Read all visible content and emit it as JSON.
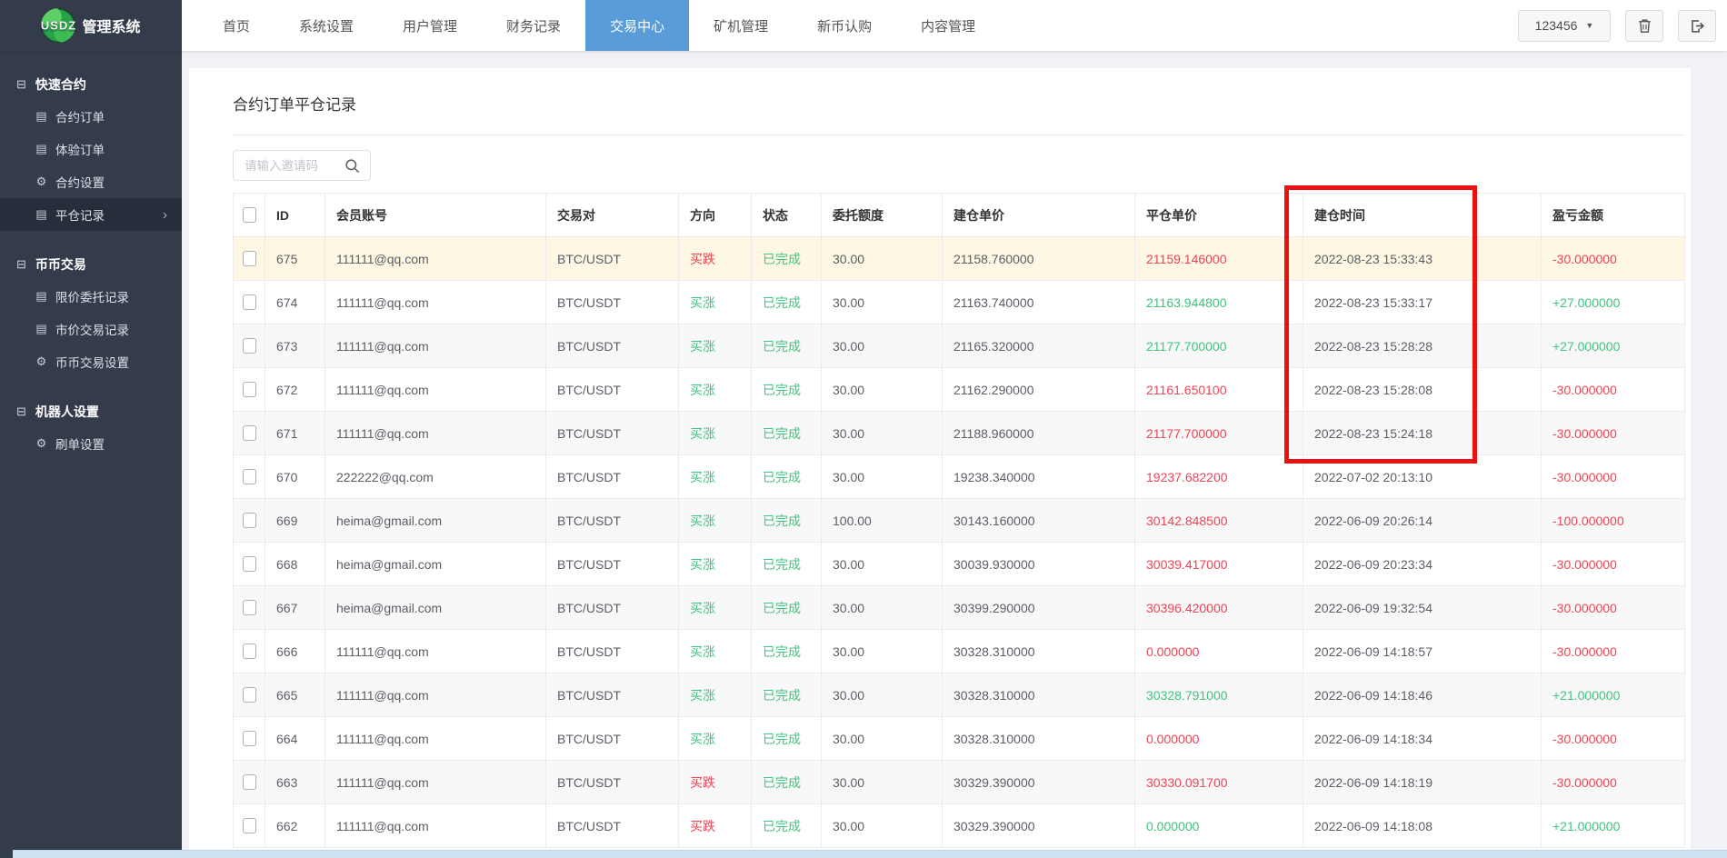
{
  "colors": {
    "nav_active_blue": "#5a9cd8",
    "green": "#3fc47f",
    "red": "#ef4455",
    "annotation_red": "#ec1111",
    "sidebar_bg": "#343b4a",
    "row_highlight": "#fdf7e3"
  },
  "topbar": {
    "brand": "USDZ",
    "brand_title": "管理系统",
    "nav": [
      {
        "label": "首页",
        "active": false
      },
      {
        "label": "系统设置",
        "active": false
      },
      {
        "label": "用户管理",
        "active": false
      },
      {
        "label": "财务记录",
        "active": false
      },
      {
        "label": "交易中心",
        "active": true
      },
      {
        "label": "矿机管理",
        "active": false
      },
      {
        "label": "新币认购",
        "active": false
      },
      {
        "label": "内容管理",
        "active": false
      }
    ],
    "account_dropdown": "123456",
    "icons": [
      "dropdown-caret",
      "trash-icon",
      "logout-icon"
    ]
  },
  "sidebar": {
    "groups": [
      {
        "label": "快速合约",
        "items": [
          {
            "label": "合约订单",
            "icon": "list-icon",
            "active": false
          },
          {
            "label": "体验订单",
            "icon": "list-icon",
            "active": false
          },
          {
            "label": "合约设置",
            "icon": "gear-icon",
            "active": false
          },
          {
            "label": "平仓记录",
            "icon": "list-icon",
            "active": true
          }
        ]
      },
      {
        "label": "币币交易",
        "items": [
          {
            "label": "限价委托记录",
            "icon": "list-icon",
            "active": false
          },
          {
            "label": "市价交易记录",
            "icon": "list-icon",
            "active": false
          },
          {
            "label": "币币交易设置",
            "icon": "gear-icon",
            "active": false
          }
        ]
      },
      {
        "label": "机器人设置",
        "items": [
          {
            "label": "刷单设置",
            "icon": "gear-icon",
            "active": false
          }
        ]
      }
    ]
  },
  "main": {
    "title": "合约订单平仓记录",
    "search_placeholder": "请输入邀请码",
    "table": {
      "columns": [
        "ID",
        "会员账号",
        "交易对",
        "方向",
        "状态",
        "委托额度",
        "建仓单价",
        "平仓单价",
        "建仓时间",
        "盈亏金额"
      ],
      "rows": [
        {
          "id": "675",
          "account": "111111@qq.com",
          "pair": "BTC/USDT",
          "direction": "买跌",
          "direction_color": "red",
          "status": "已完成",
          "amount": "30.00",
          "open_price": "21158.760000",
          "close_price": "21159.146000",
          "close_color": "red",
          "open_time": "2022-08-23 15:33:43",
          "pnl": "-30.000000",
          "pnl_color": "red",
          "highlight": true
        },
        {
          "id": "674",
          "account": "111111@qq.com",
          "pair": "BTC/USDT",
          "direction": "买涨",
          "direction_color": "green",
          "status": "已完成",
          "amount": "30.00",
          "open_price": "21163.740000",
          "close_price": "21163.944800",
          "close_color": "green",
          "open_time": "2022-08-23 15:33:17",
          "pnl": "+27.000000",
          "pnl_color": "green",
          "highlight": false
        },
        {
          "id": "673",
          "account": "111111@qq.com",
          "pair": "BTC/USDT",
          "direction": "买涨",
          "direction_color": "green",
          "status": "已完成",
          "amount": "30.00",
          "open_price": "21165.320000",
          "close_price": "21177.700000",
          "close_color": "green",
          "open_time": "2022-08-23 15:28:28",
          "pnl": "+27.000000",
          "pnl_color": "green",
          "highlight": false
        },
        {
          "id": "672",
          "account": "111111@qq.com",
          "pair": "BTC/USDT",
          "direction": "买涨",
          "direction_color": "green",
          "status": "已完成",
          "amount": "30.00",
          "open_price": "21162.290000",
          "close_price": "21161.650100",
          "close_color": "red",
          "open_time": "2022-08-23 15:28:08",
          "pnl": "-30.000000",
          "pnl_color": "red",
          "highlight": false
        },
        {
          "id": "671",
          "account": "111111@qq.com",
          "pair": "BTC/USDT",
          "direction": "买涨",
          "direction_color": "green",
          "status": "已完成",
          "amount": "30.00",
          "open_price": "21188.960000",
          "close_price": "21177.700000",
          "close_color": "red",
          "open_time": "2022-08-23 15:24:18",
          "pnl": "-30.000000",
          "pnl_color": "red",
          "highlight": false
        },
        {
          "id": "670",
          "account": "222222@qq.com",
          "pair": "BTC/USDT",
          "direction": "买涨",
          "direction_color": "green",
          "status": "已完成",
          "amount": "30.00",
          "open_price": "19238.340000",
          "close_price": "19237.682200",
          "close_color": "red",
          "open_time": "2022-07-02 20:13:10",
          "pnl": "-30.000000",
          "pnl_color": "red",
          "highlight": false
        },
        {
          "id": "669",
          "account": "heima@gmail.com",
          "pair": "BTC/USDT",
          "direction": "买涨",
          "direction_color": "green",
          "status": "已完成",
          "amount": "100.00",
          "open_price": "30143.160000",
          "close_price": "30142.848500",
          "close_color": "red",
          "open_time": "2022-06-09 20:26:14",
          "pnl": "-100.000000",
          "pnl_color": "red",
          "highlight": false
        },
        {
          "id": "668",
          "account": "heima@gmail.com",
          "pair": "BTC/USDT",
          "direction": "买涨",
          "direction_color": "green",
          "status": "已完成",
          "amount": "30.00",
          "open_price": "30039.930000",
          "close_price": "30039.417000",
          "close_color": "red",
          "open_time": "2022-06-09 20:23:34",
          "pnl": "-30.000000",
          "pnl_color": "red",
          "highlight": false
        },
        {
          "id": "667",
          "account": "heima@gmail.com",
          "pair": "BTC/USDT",
          "direction": "买涨",
          "direction_color": "green",
          "status": "已完成",
          "amount": "30.00",
          "open_price": "30399.290000",
          "close_price": "30396.420000",
          "close_color": "red",
          "open_time": "2022-06-09 19:32:54",
          "pnl": "-30.000000",
          "pnl_color": "red",
          "highlight": false
        },
        {
          "id": "666",
          "account": "111111@qq.com",
          "pair": "BTC/USDT",
          "direction": "买涨",
          "direction_color": "green",
          "status": "已完成",
          "amount": "30.00",
          "open_price": "30328.310000",
          "close_price": "0.000000",
          "close_color": "red",
          "open_time": "2022-06-09 14:18:57",
          "pnl": "-30.000000",
          "pnl_color": "red",
          "highlight": false
        },
        {
          "id": "665",
          "account": "111111@qq.com",
          "pair": "BTC/USDT",
          "direction": "买涨",
          "direction_color": "green",
          "status": "已完成",
          "amount": "30.00",
          "open_price": "30328.310000",
          "close_price": "30328.791000",
          "close_color": "green",
          "open_time": "2022-06-09 14:18:46",
          "pnl": "+21.000000",
          "pnl_color": "green",
          "highlight": false
        },
        {
          "id": "664",
          "account": "111111@qq.com",
          "pair": "BTC/USDT",
          "direction": "买涨",
          "direction_color": "green",
          "status": "已完成",
          "amount": "30.00",
          "open_price": "30328.310000",
          "close_price": "0.000000",
          "close_color": "red",
          "open_time": "2022-06-09 14:18:34",
          "pnl": "-30.000000",
          "pnl_color": "red",
          "highlight": false
        },
        {
          "id": "663",
          "account": "111111@qq.com",
          "pair": "BTC/USDT",
          "direction": "买跌",
          "direction_color": "red",
          "status": "已完成",
          "amount": "30.00",
          "open_price": "30329.390000",
          "close_price": "30330.091700",
          "close_color": "red",
          "open_time": "2022-06-09 14:18:19",
          "pnl": "-30.000000",
          "pnl_color": "red",
          "highlight": false
        },
        {
          "id": "662",
          "account": "111111@qq.com",
          "pair": "BTC/USDT",
          "direction": "买跌",
          "direction_color": "red",
          "status": "已完成",
          "amount": "30.00",
          "open_price": "30329.390000",
          "close_price": "0.000000",
          "close_color": "green",
          "open_time": "2022-06-09 14:18:08",
          "pnl": "+21.000000",
          "pnl_color": "green",
          "highlight": false
        }
      ]
    }
  },
  "annotation": {
    "highlighted_column": "建仓时间",
    "shape": "red-box"
  }
}
